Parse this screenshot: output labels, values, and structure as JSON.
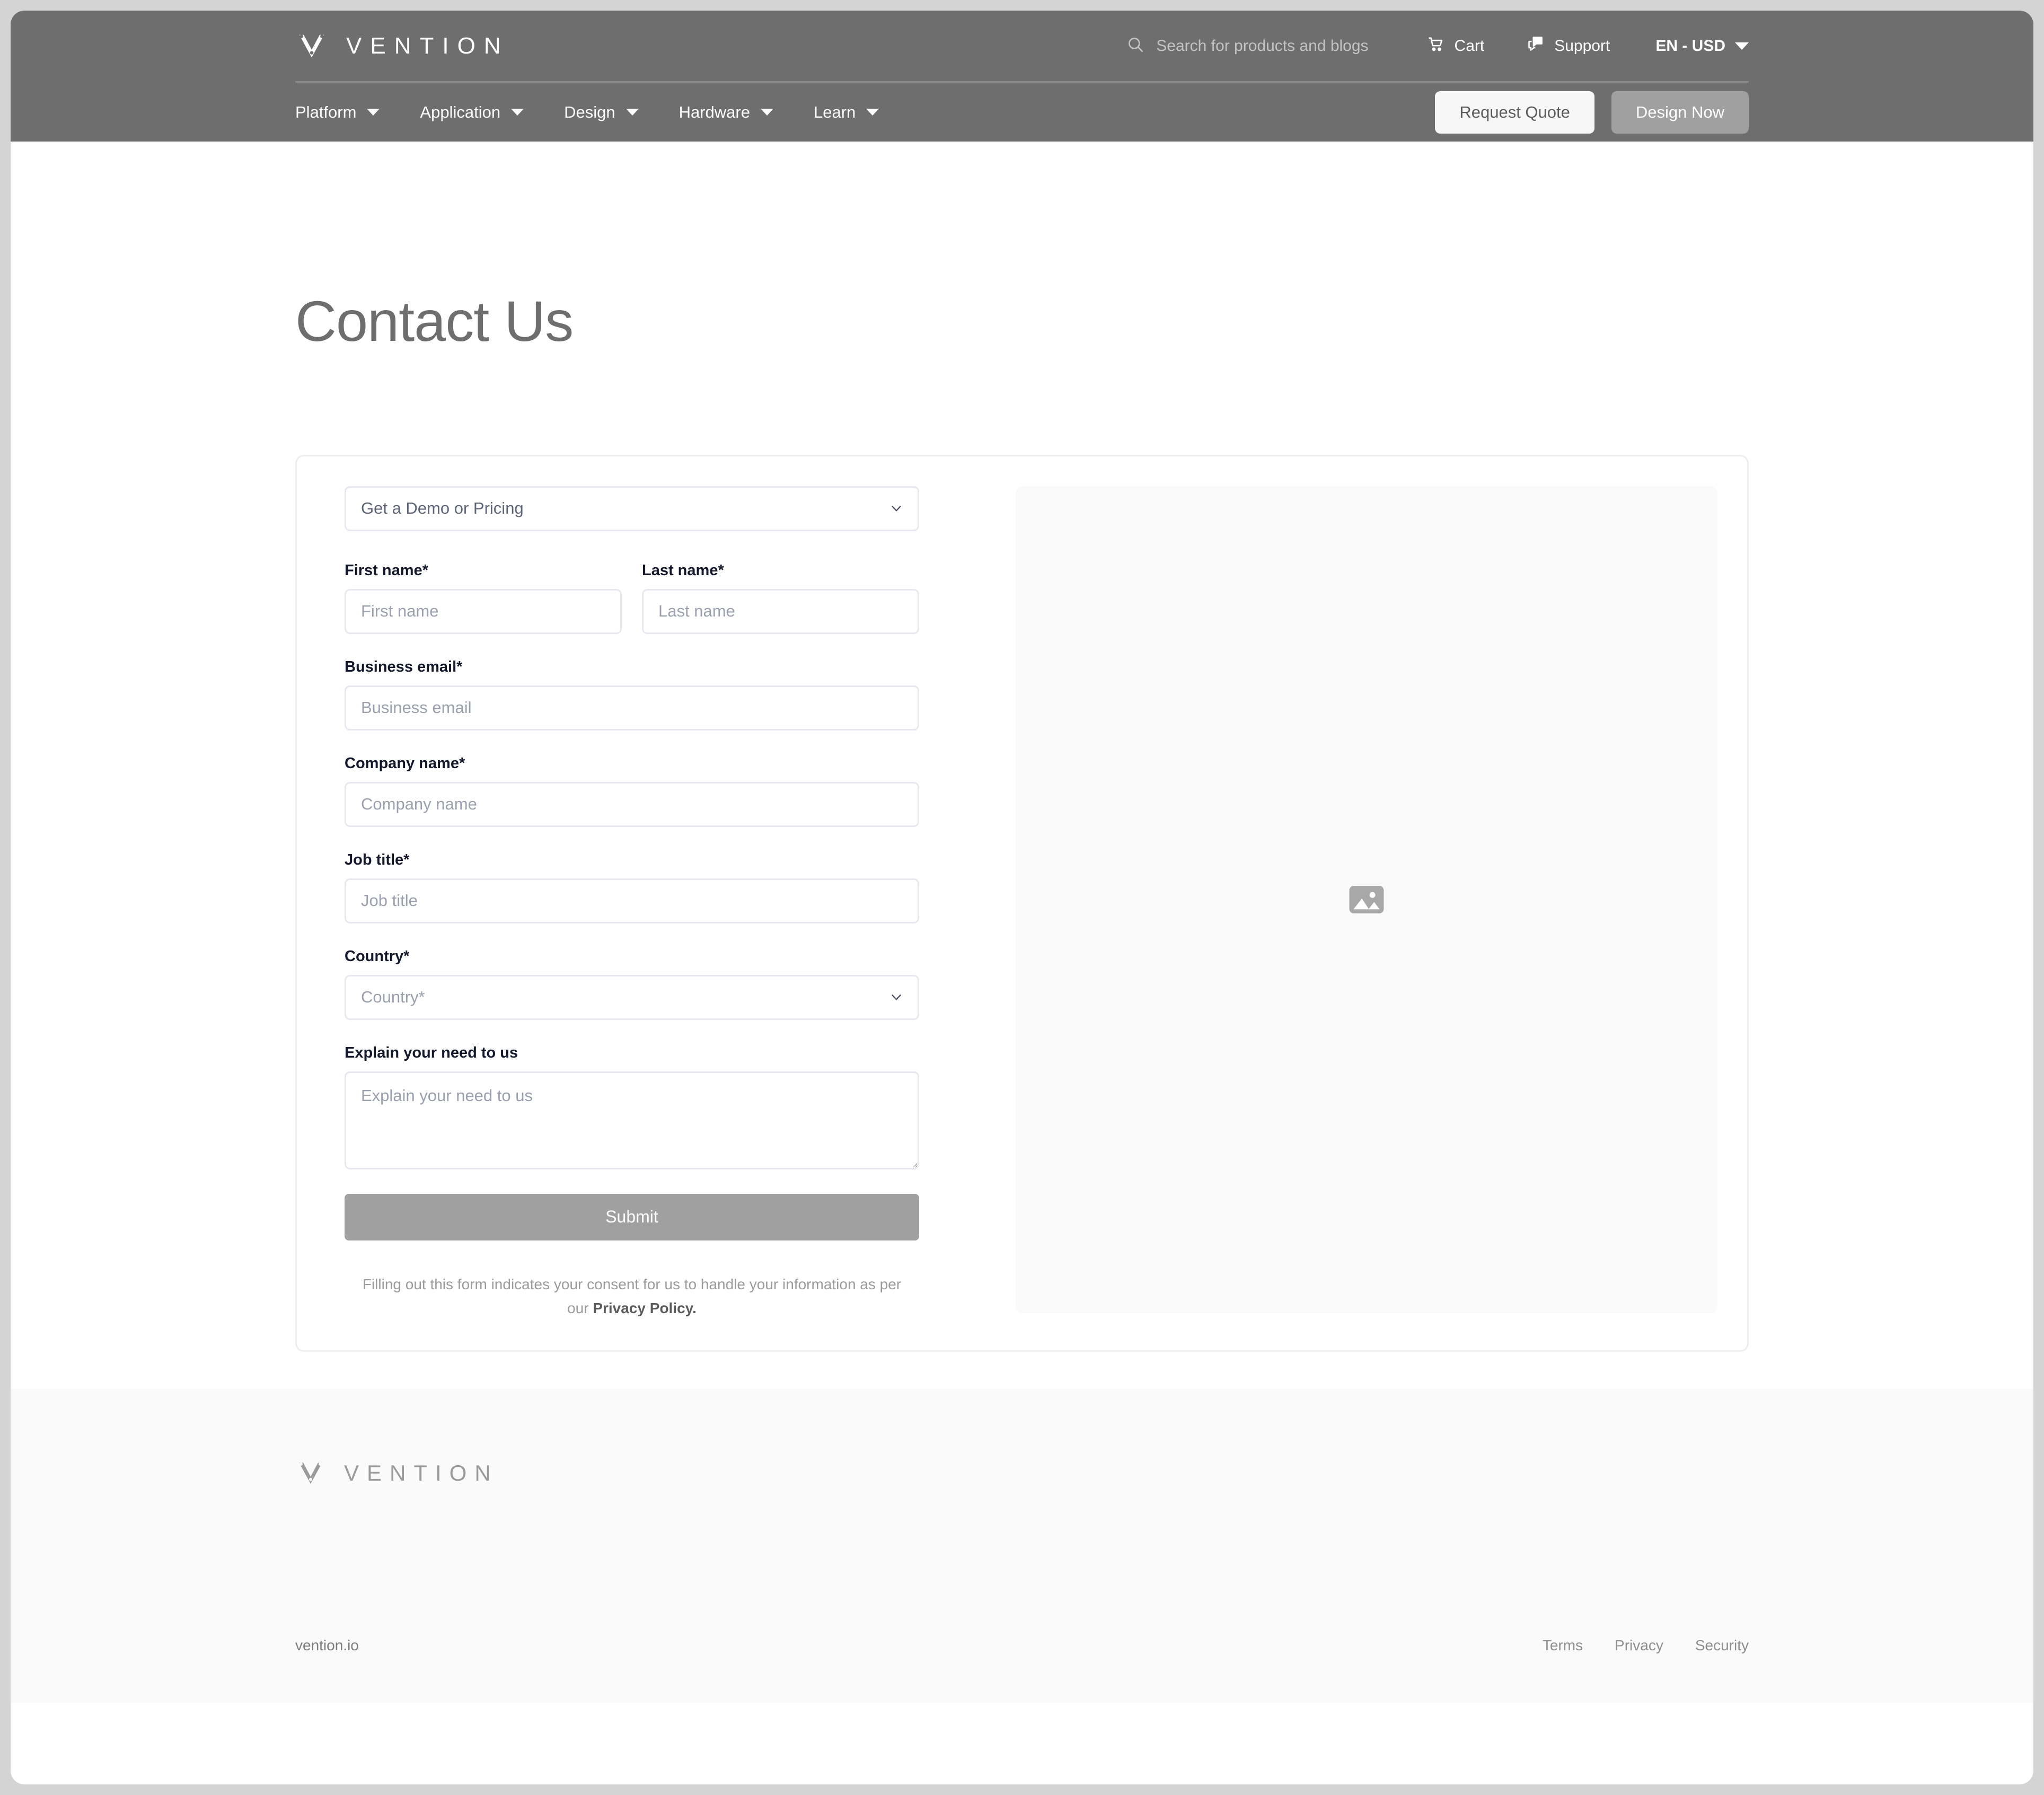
{
  "header": {
    "brand": "VENTION",
    "search": {
      "placeholder": "Search for products and blogs",
      "icon": "search-icon"
    },
    "cart": {
      "label": "Cart",
      "icon": "cart-icon"
    },
    "support": {
      "label": "Support",
      "icon": "support-chat-icon"
    },
    "locale": {
      "label": "EN - USD",
      "icon": "chevron-down-icon"
    },
    "nav": [
      {
        "label": "Platform"
      },
      {
        "label": "Application"
      },
      {
        "label": "Design"
      },
      {
        "label": "Hardware"
      },
      {
        "label": "Learn"
      }
    ],
    "buttons": {
      "request_quote": "Request Quote",
      "design_now": "Design Now"
    }
  },
  "main": {
    "title": "Contact Us",
    "form": {
      "topic_select": {
        "value": "Get a Demo or Pricing",
        "icon": "chevron-down-icon"
      },
      "first_name": {
        "label": "First name*",
        "placeholder": "First name",
        "value": ""
      },
      "last_name": {
        "label": "Last name*",
        "placeholder": "Last name",
        "value": ""
      },
      "business_email": {
        "label": "Business email*",
        "placeholder": "Business email",
        "value": ""
      },
      "company_name": {
        "label": "Company name*",
        "placeholder": "Company name",
        "value": ""
      },
      "job_title": {
        "label": "Job title*",
        "placeholder": "Job title",
        "value": ""
      },
      "country": {
        "label": "Country*",
        "placeholder": "Country*",
        "value": "",
        "icon": "chevron-down-icon"
      },
      "need": {
        "label": "Explain your need to us",
        "placeholder": "Explain your need to us",
        "value": ""
      },
      "submit_label": "Submit",
      "consent_text": "Filling out this form indicates your consent for us to handle your information as per our ",
      "consent_link": "Privacy Policy."
    },
    "media": {
      "icon": "image-placeholder-icon"
    }
  },
  "footer": {
    "brand": "VENTION",
    "domain": "vention.io",
    "links": [
      {
        "label": "Terms"
      },
      {
        "label": "Privacy"
      },
      {
        "label": "Security"
      }
    ]
  },
  "colors": {
    "header_bg": "#6e6e6e",
    "accent_button": "#a0a0a0",
    "label_text": "#13182b",
    "placeholder": "#9aa0ae",
    "border": "#e6e9ef",
    "panel_bg": "#fafafa"
  }
}
